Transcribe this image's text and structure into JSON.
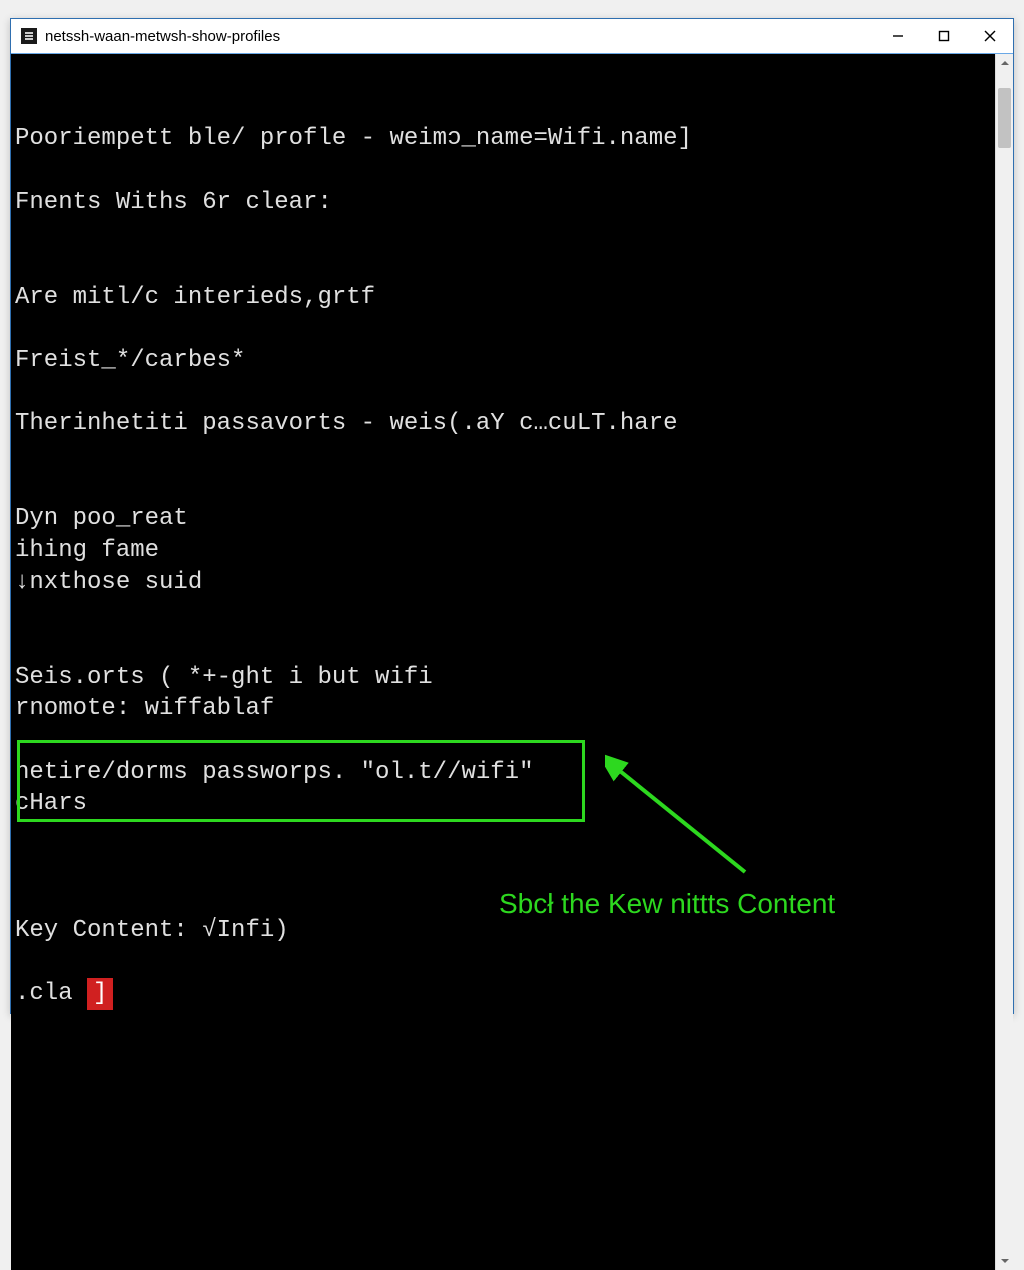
{
  "titlebar": {
    "title": "netssh-waan-metwsh-show-profiles"
  },
  "terminal": {
    "lines": [
      "",
      "",
      "Pooriempett ble/ profle - weimɔ_name=Wifi.name]",
      "",
      "Fnents Withs 6r clear:",
      "",
      "",
      "Are mitl/c interieds,grtf",
      "",
      "Freist_*/carbes*",
      "",
      "Therinhetiti passavorts - weis(.aY c…cuLT.hare",
      "",
      "",
      "Dyn poo_reat",
      "ihing fame",
      "↓nxthose suid",
      "",
      "",
      "Seis.orts ( *+-ght i but wifi",
      "rnomote: wiffablaf",
      "",
      "netire/dorms passworps. \"ol.t//wifi\"",
      "cHars",
      "",
      "",
      "",
      "Key Content: √Infi)",
      ""
    ],
    "prompt_prefix": ".cla ",
    "prompt_cursor": "]"
  },
  "annotation": {
    "label": "Sbcł the Kew nittts Content"
  },
  "colors": {
    "accent_green": "#2dd81f",
    "cursor_red": "#d02020"
  }
}
